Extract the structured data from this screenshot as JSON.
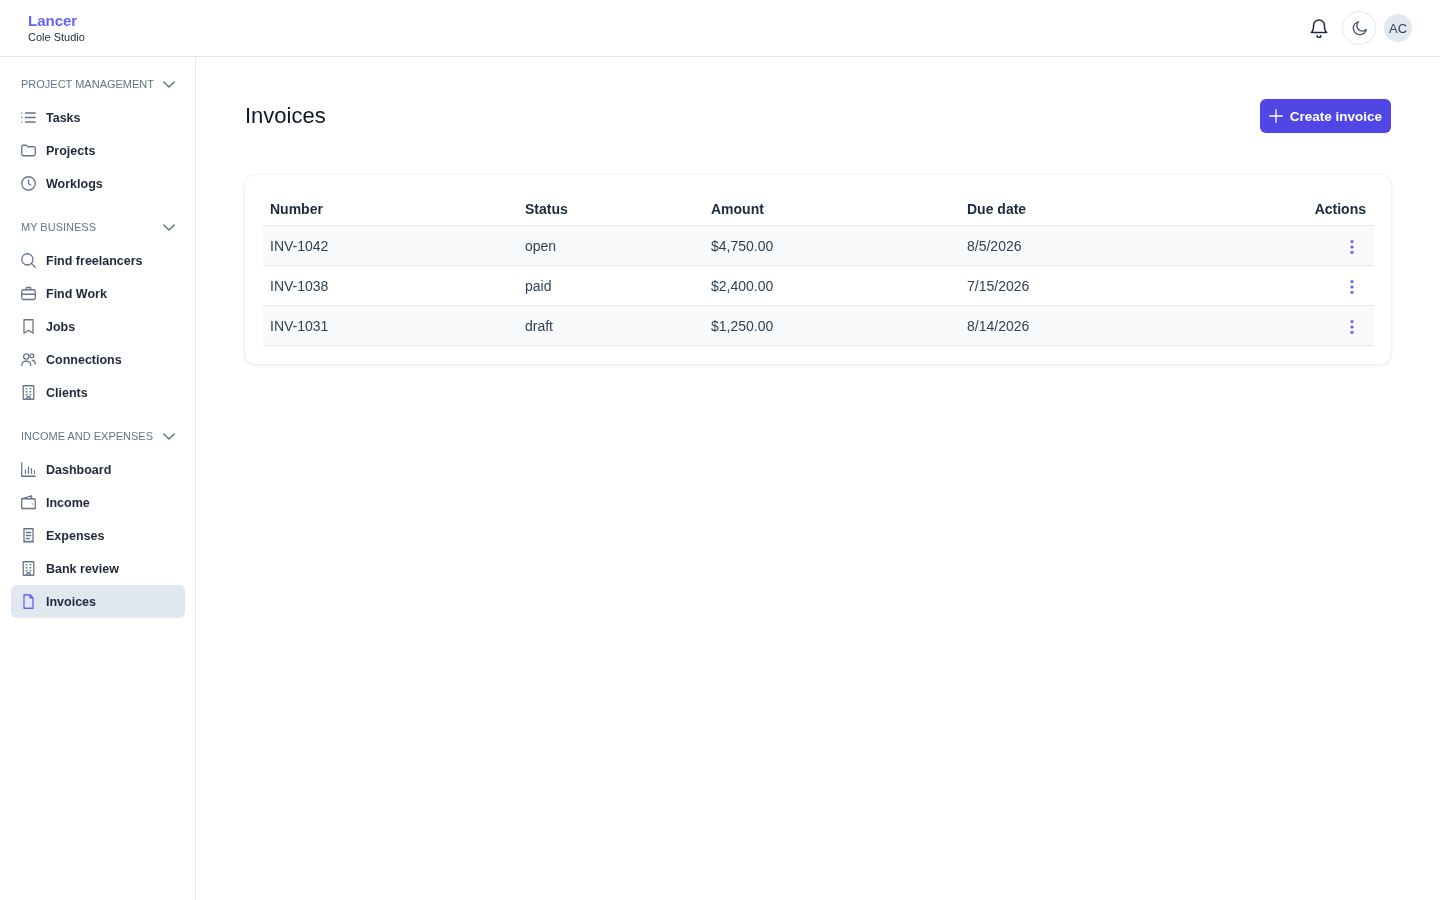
{
  "header": {
    "brand": "Lancer",
    "workspace": "Cole Studio",
    "avatar_initials": "AC"
  },
  "sidebar": {
    "sections": [
      {
        "title": "PROJECT MANAGEMENT",
        "expanded": true,
        "items": [
          {
            "label": "Tasks",
            "selected": false
          },
          {
            "label": "Projects",
            "selected": false
          },
          {
            "label": "Worklogs",
            "selected": false
          }
        ]
      },
      {
        "title": "MY BUSINESS",
        "expanded": true,
        "items": [
          {
            "label": "Find freelancers",
            "selected": false
          },
          {
            "label": "Find Work",
            "selected": false
          },
          {
            "label": "Jobs",
            "selected": false
          },
          {
            "label": "Connections",
            "selected": false
          },
          {
            "label": "Clients",
            "selected": false
          }
        ]
      },
      {
        "title": "INCOME AND EXPENSES",
        "expanded": true,
        "items": [
          {
            "label": "Dashboard",
            "selected": false
          },
          {
            "label": "Income",
            "selected": false
          },
          {
            "label": "Expenses",
            "selected": false
          },
          {
            "label": "Bank review",
            "selected": false
          },
          {
            "label": "Invoices",
            "selected": true
          }
        ]
      }
    ]
  },
  "page": {
    "title": "Invoices",
    "create_button": "Create invoice"
  },
  "table": {
    "columns": [
      "Number",
      "Status",
      "Amount",
      "Due date",
      "Actions"
    ],
    "rows": [
      {
        "cells": [
          "INV-1042",
          "open",
          "$4,750.00",
          "8/5/2026"
        ]
      },
      {
        "cells": [
          "INV-1038",
          "paid",
          "$2,400.00",
          "7/15/2026"
        ]
      },
      {
        "cells": [
          "INV-1031",
          "draft",
          "$1,250.00",
          "8/14/2026"
        ]
      }
    ]
  }
}
